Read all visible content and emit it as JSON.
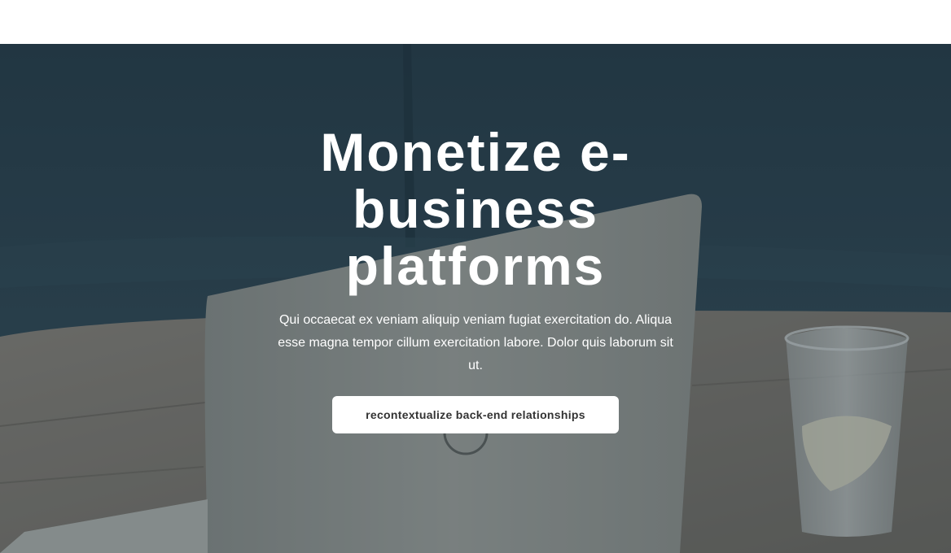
{
  "hero": {
    "title": "Monetize e-business platforms",
    "subtitle": "Qui occaecat ex veniam aliquip veniam fugiat exercitation do. Aliqua esse magna tempor cillum exercitation labore. Dolor quis laborum sit ut.",
    "cta_label": "recontextualize back-end relationships"
  },
  "colors": {
    "sofa": "#2f4b5a",
    "table": "#8a8578",
    "laptop": "#a9aca6",
    "button_bg": "#ffffff",
    "button_text": "#333333"
  },
  "icons": {
    "laptop_logo": "dell-logo-icon"
  }
}
